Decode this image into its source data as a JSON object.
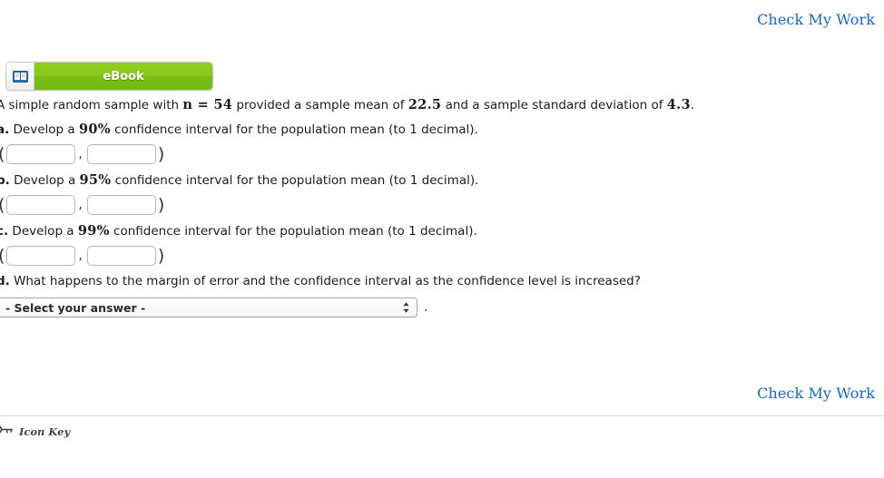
{
  "links": {
    "check_my_work_top": "Check My Work",
    "check_my_work_bottom": "Check My Work"
  },
  "ebook_button": {
    "label": "eBook",
    "icon": "open-book-icon"
  },
  "problem": {
    "intro": {
      "text_before_n": "A simple random sample with ",
      "n_symbol": "n = 54",
      "text_after_n": " provided a sample mean of ",
      "sample_mean": "22.5",
      "text_after_mean": " and a sample standard deviation of ",
      "sample_sd": "4.3",
      "period": "."
    },
    "parts": [
      {
        "id": "a",
        "marker": "a.",
        "text_before": " Develop a ",
        "level": "90%",
        "text_after": " confidence interval for the population mean (to 1 decimal).",
        "lower_value": "",
        "upper_value": "",
        "open_paren": "(",
        "comma": ",",
        "close_paren": ")"
      },
      {
        "id": "b",
        "marker": "b.",
        "text_before": " Develop a ",
        "level": "95%",
        "text_after": " confidence interval for the population mean (to 1 decimal).",
        "lower_value": "",
        "upper_value": "",
        "open_paren": "(",
        "comma": ",",
        "close_paren": ")"
      },
      {
        "id": "c",
        "marker": "c.",
        "text_before": " Develop a ",
        "level": "99%",
        "text_after": " confidence interval for the population mean (to 1 decimal).",
        "lower_value": "",
        "upper_value": "",
        "open_paren": "(",
        "comma": ",",
        "close_paren": ")"
      }
    ],
    "part_d": {
      "marker": "d.",
      "text": " What happens to the margin of error and the confidence interval as the confidence level is increased?",
      "select_value": "- Select your answer -",
      "trailing_period": "."
    }
  },
  "footer": {
    "icon_key_label": "Icon Key",
    "icon": "key-icon"
  },
  "colors": {
    "link_blue": "#1268d3",
    "ebook_green_top": "#93cd20",
    "ebook_green_bottom": "#74ba13",
    "divider": "#d2d2d2"
  }
}
